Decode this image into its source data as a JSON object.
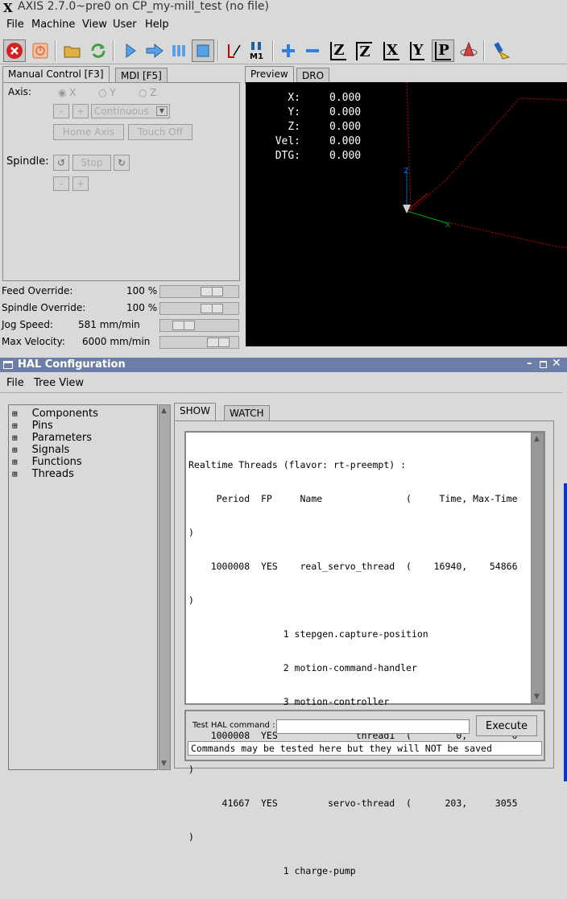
{
  "window": {
    "title": "AXIS 2.7.0~pre0 on CP_my-mill_test (no file)"
  },
  "menu": [
    "File",
    "Machine",
    "View",
    "User",
    "Help"
  ],
  "toolbar_icons": [
    "estop-icon",
    "power-icon",
    "open-file-icon",
    "reload-icon",
    "run-icon",
    "step-icon",
    "pause-icon",
    "stop-icon",
    "block-delete-icon",
    "optional-stop-icon",
    "zoom-in-icon",
    "zoom-out-icon",
    "view-z-icon",
    "view-z2-icon",
    "view-x-icon",
    "view-y-icon",
    "view-p-icon",
    "rotate-icon",
    "clear-icon"
  ],
  "toolbar_labels": {
    "m1": "M1",
    "z": "Z",
    "z2": "Z",
    "x": "X",
    "y": "Y",
    "p": "P"
  },
  "left_tabs": {
    "manual": "Manual Control [F3]",
    "mdi": "MDI [F5]"
  },
  "manual": {
    "axis_label": "Axis:",
    "axes": [
      "X",
      "Y",
      "Z"
    ],
    "minus": "-",
    "plus": "+",
    "jog_mode": "Continuous",
    "home_axis": "Home Axis",
    "touch_off": "Touch Off",
    "spindle_label": "Spindle:",
    "stop": "Stop"
  },
  "overrides": {
    "feed_label": "Feed Override:",
    "feed_value": "100 %",
    "feed_level": 0.75,
    "spindle_label": "Spindle Override:",
    "spindle_value": "100 %",
    "spindle_level": 0.75,
    "jog_label": "Jog Speed:",
    "jog_value": "581 mm/min",
    "jog_level": 0.22,
    "maxvel_label": "Max Velocity:",
    "maxvel_value": "6000 mm/min",
    "maxvel_level": 0.86
  },
  "right_tabs": {
    "preview": "Preview",
    "dro": "DRO"
  },
  "dro": [
    {
      "label": "X:",
      "value": "0.000"
    },
    {
      "label": "Y:",
      "value": "0.000"
    },
    {
      "label": "Z:",
      "value": "0.000"
    },
    {
      "label": "Vel:",
      "value": "0.000"
    },
    {
      "label": "DTG:",
      "value": "0.000"
    }
  ],
  "axis_letters": {
    "z": "Z",
    "x": "X"
  },
  "colors": {
    "hal_title": "#6d7fa8",
    "estop": "#d62020",
    "tool_red": "#d00000",
    "tool_green": "#00aa00",
    "tool_blue": "#1060d0",
    "preview_bg": "#000000"
  },
  "hal": {
    "title": "HAL Configuration",
    "menu": [
      "File",
      "Tree View"
    ],
    "tree": [
      "Components",
      "Pins",
      "Parameters",
      "Signals",
      "Functions",
      "Threads"
    ],
    "tabs": {
      "show": "SHOW",
      "watch": "WATCH"
    },
    "output": [
      "Realtime Threads (flavor: rt-preempt) :",
      "     Period  FP     Name               (     Time, Max-Time",
      ")",
      "    1000008  YES    real_servo_thread  (    16940,    54866",
      ")",
      "                 1 stepgen.capture-position",
      "                 2 motion-command-handler",
      "                 3 motion-controller",
      "    1000008  YES              thread1  (        0,        0",
      ")",
      "      41667  YES         servo-thread  (      203,     3055",
      ")",
      "                 1 charge-pump"
    ],
    "test_label": "Test HAL command :",
    "test_value": "",
    "execute": "Execute",
    "note": "Commands may be tested here but they will NOT be saved"
  }
}
